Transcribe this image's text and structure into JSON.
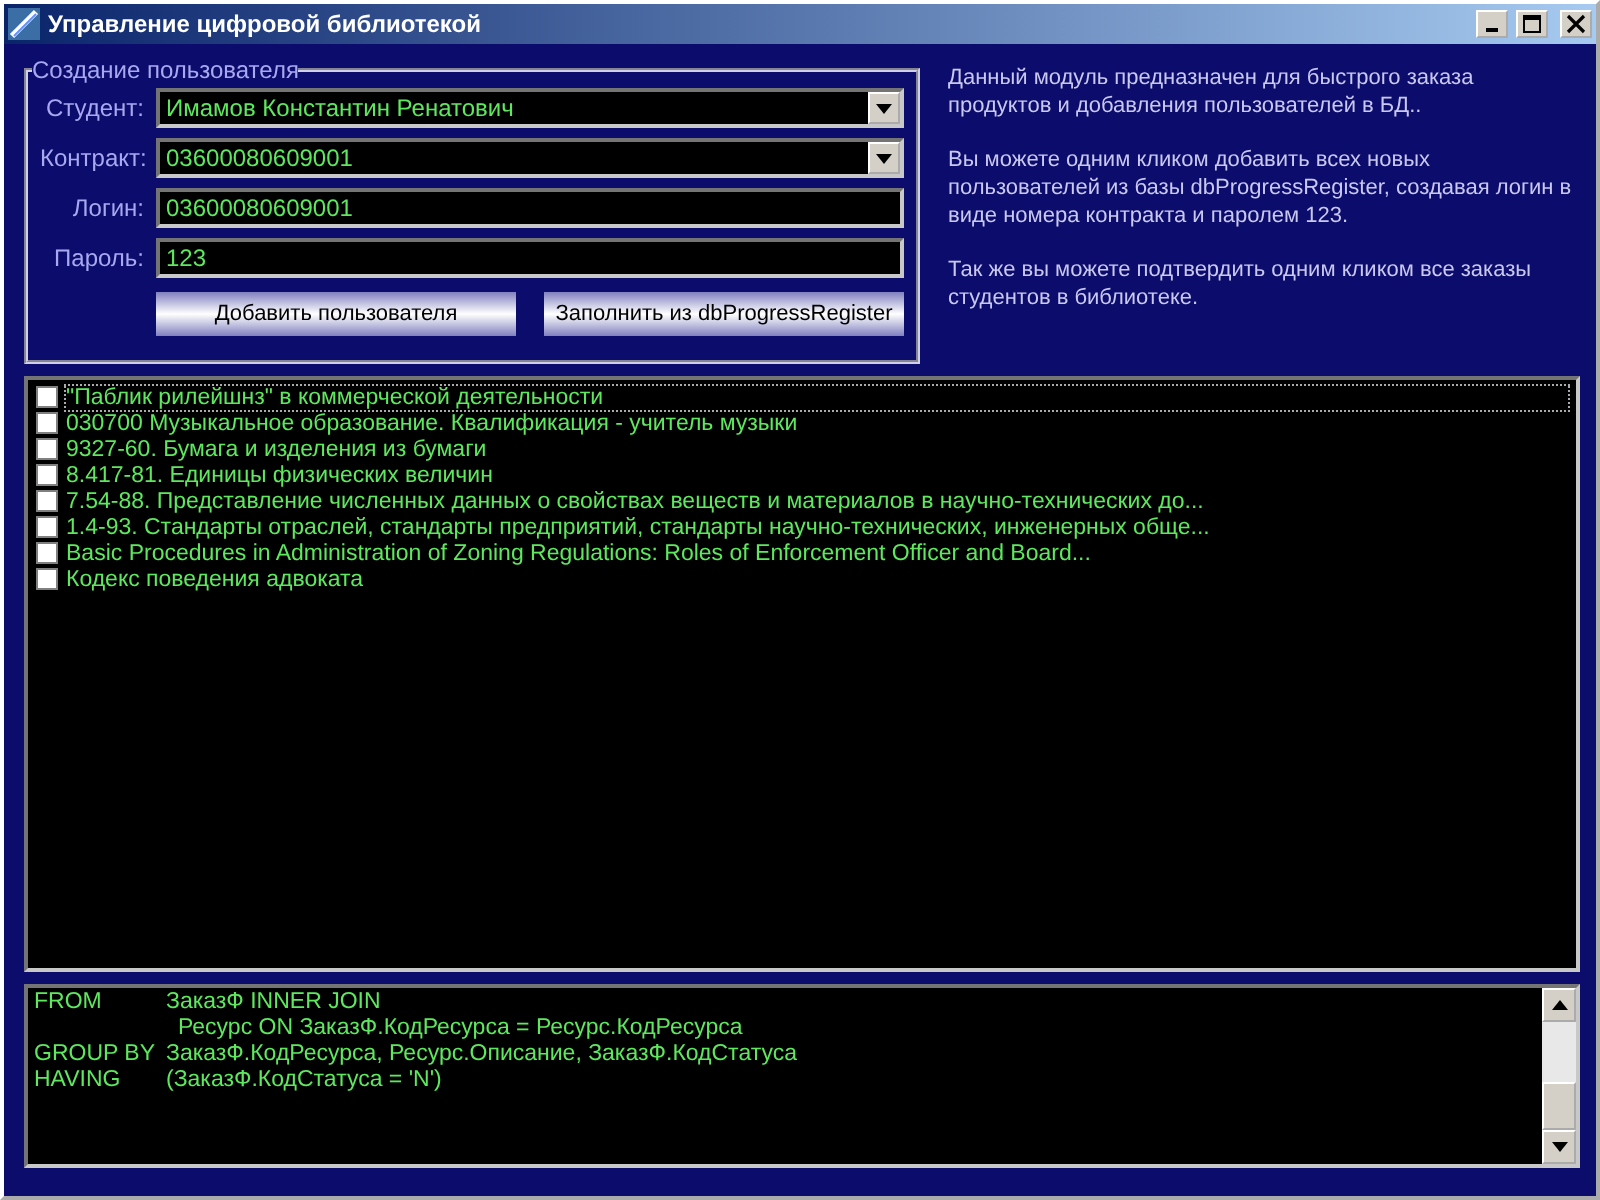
{
  "window": {
    "title": "Управление цифровой библиотекой"
  },
  "user_form": {
    "legend": "Создание пользователя",
    "fields": [
      {
        "kind": "dropdown",
        "label": "Студент:",
        "value": "Имамов Константин Ренатович"
      },
      {
        "kind": "dropdown",
        "label": "Контракт:",
        "value": "03600080609001"
      },
      {
        "kind": "text",
        "label": "Логин:",
        "value": "03600080609001"
      },
      {
        "kind": "text",
        "label": "Пароль:",
        "value": "123"
      }
    ],
    "buttons": [
      "Добавить пользователя",
      "Заполнить из dbProgressRegister"
    ]
  },
  "info": [
    "Данный модуль предназначен для быстрого заказа продуктов и добавления пользователей в БД..",
    "Вы можете одним кликом добавить всех новых пользователей из базы dbProgressRegister, создавая логин в виде номера контракта и паролем 123.",
    "Так же вы можете подтвердить одним кликом все заказы студентов в библиотеке."
  ],
  "resources": [
    {
      "label": "\"Паблик рилейшнз\" в коммерческой деятельности",
      "checked": false,
      "selected": true
    },
    {
      "label": "030700  Музыкальное образование. Квалификация - учитель музыки",
      "checked": false,
      "selected": false
    },
    {
      "label": "9327-60. Бумага и изделения из бумаги",
      "checked": false,
      "selected": false
    },
    {
      "label": "8.417-81. Единицы физических величин",
      "checked": false,
      "selected": false
    },
    {
      "label": "7.54-88. Представление численных данных о свойствах веществ и материалов в научно-технических до...",
      "checked": false,
      "selected": false
    },
    {
      "label": "1.4-93. Стандарты отраслей, стандарты предприятий, стандарты научно-технических, инженерных обще...",
      "checked": false,
      "selected": false
    },
    {
      "label": "Basic Procedures in Administration of Zoning Regulations: Roles of Enforcement Officer and Board...",
      "checked": false,
      "selected": false
    },
    {
      "label": " Кодекс поведения адвоката",
      "checked": false,
      "selected": false
    }
  ],
  "sql": [
    {
      "kind": "clause",
      "keyword": "FROM",
      "text": "ЗаказФ INNER JOIN"
    },
    {
      "kind": "continuation",
      "text": "Ресурс ON ЗаказФ.КодРесурса = Ресурс.КодРесурса"
    },
    {
      "kind": "clause",
      "keyword": "GROUP BY",
      "text": "ЗаказФ.КодРесурса, Ресурс.Описание, ЗаказФ.КодСтатуса"
    },
    {
      "kind": "clause",
      "keyword": "HAVING",
      "text": "(ЗаказФ.КодСтатуса = 'N')"
    }
  ]
}
